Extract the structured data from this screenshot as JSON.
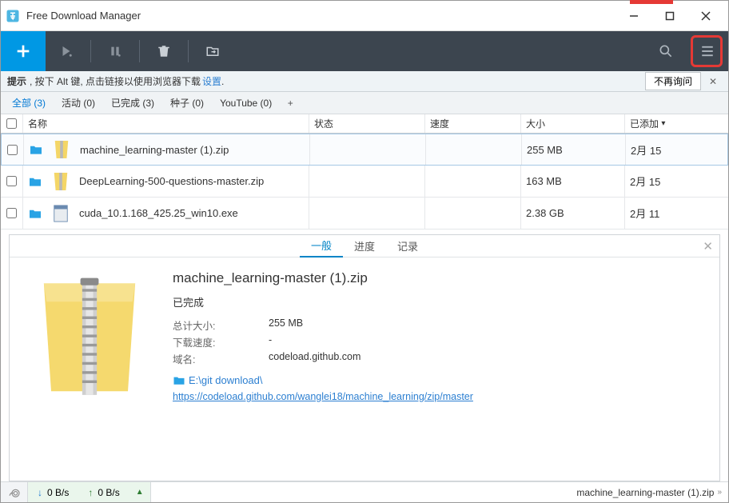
{
  "window": {
    "title": "Free Download Manager"
  },
  "tipbar": {
    "label": "提示",
    "text": ", 按下 Alt 键, 点击链接以使用浏览器下载",
    "link": "设置",
    "no_ask": "不再询问"
  },
  "tabs": [
    {
      "label": "全部 (3)",
      "active": true
    },
    {
      "label": "活动 (0)"
    },
    {
      "label": "已完成 (3)"
    },
    {
      "label": "种子 (0)"
    },
    {
      "label": "YouTube (0)"
    }
  ],
  "columns": {
    "name": "名称",
    "status": "状态",
    "speed": "速度",
    "size": "大小",
    "added": "已添加"
  },
  "rows": [
    {
      "name": "machine_learning-master (1).zip",
      "status": "",
      "speed": "",
      "size": "255 MB",
      "added": "2月 15",
      "icon": "zip",
      "selected": true
    },
    {
      "name": "DeepLearning-500-questions-master.zip",
      "status": "",
      "speed": "",
      "size": "163 MB",
      "added": "2月 15",
      "icon": "zip"
    },
    {
      "name": "cuda_10.1.168_425.25_win10.exe",
      "status": "",
      "speed": "",
      "size": "2.38 GB",
      "added": "2月 11",
      "icon": "exe"
    }
  ],
  "panel": {
    "tabs": {
      "general": "一般",
      "progress": "进度",
      "log": "记录"
    },
    "title": "machine_learning-master (1).zip",
    "status": "已完成",
    "fields": {
      "size_label": "总计大小:",
      "size_value": "255 MB",
      "speed_label": "下载速度:",
      "speed_value": "-",
      "domain_label": "域名:",
      "domain_value": "codeload.github.com"
    },
    "path": "E:\\git download\\",
    "url": "https://codeload.github.com/wanglei18/machine_learning/zip/master"
  },
  "statusbar": {
    "down": "0 B/s",
    "up": "0 B/s",
    "file": "machine_learning-master (1).zip"
  }
}
